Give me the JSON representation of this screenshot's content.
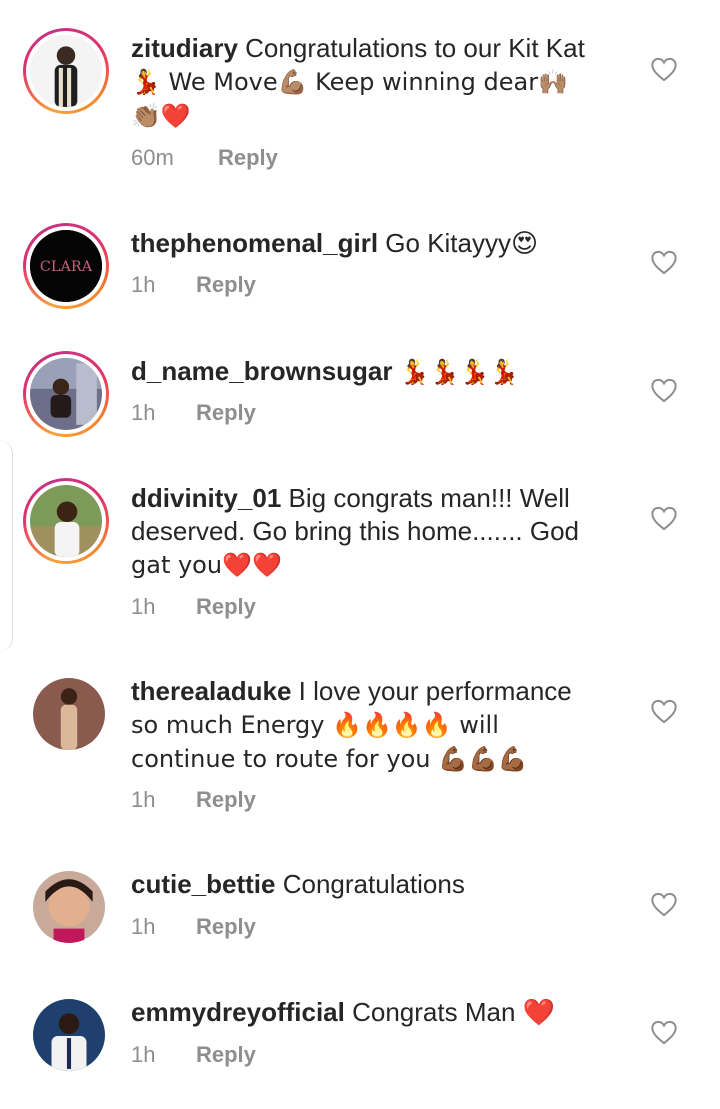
{
  "comments": [
    {
      "username": "zitudiary",
      "text": "Congratulations to our Kit Kat",
      "line2": "💃 We Move💪🏽 Keep winning dear🙌🏽",
      "line3": "👏🏽❤️",
      "time": "60m",
      "reply": "Reply"
    },
    {
      "username": "thephenomenal_girl",
      "text": "Go Kitayyy😍",
      "time": "1h",
      "reply": "Reply",
      "avatar_text": "CLARA"
    },
    {
      "username": "d_name_brownsugar",
      "text": "💃💃💃💃",
      "time": "1h",
      "reply": "Reply"
    },
    {
      "username": "ddivinity_01",
      "text": "Big congrats man!!! Well",
      "line2": "deserved. Go bring this home....... God",
      "line3": "gat you❤️❤️",
      "time": "1h",
      "reply": "Reply"
    },
    {
      "username": "therealaduke",
      "text": "I love your performance",
      "line2": "so much Energy 🔥🔥🔥🔥 will",
      "line3": "continue to route for you 💪🏾💪🏾💪🏾",
      "time": "1h",
      "reply": "Reply"
    },
    {
      "username": "cutie_bettie",
      "text": "Congratulations",
      "time": "1h",
      "reply": "Reply"
    },
    {
      "username": "emmydreyofficial",
      "text": "Congrats Man ❤️",
      "time": "1h",
      "reply": "Reply"
    }
  ],
  "icons": {
    "like": "heart-outline-icon"
  },
  "colors": {
    "text": "#262626",
    "muted": "#8e8e8e",
    "story_ring_start": "#f9a23b",
    "story_ring_end": "#c13584"
  }
}
